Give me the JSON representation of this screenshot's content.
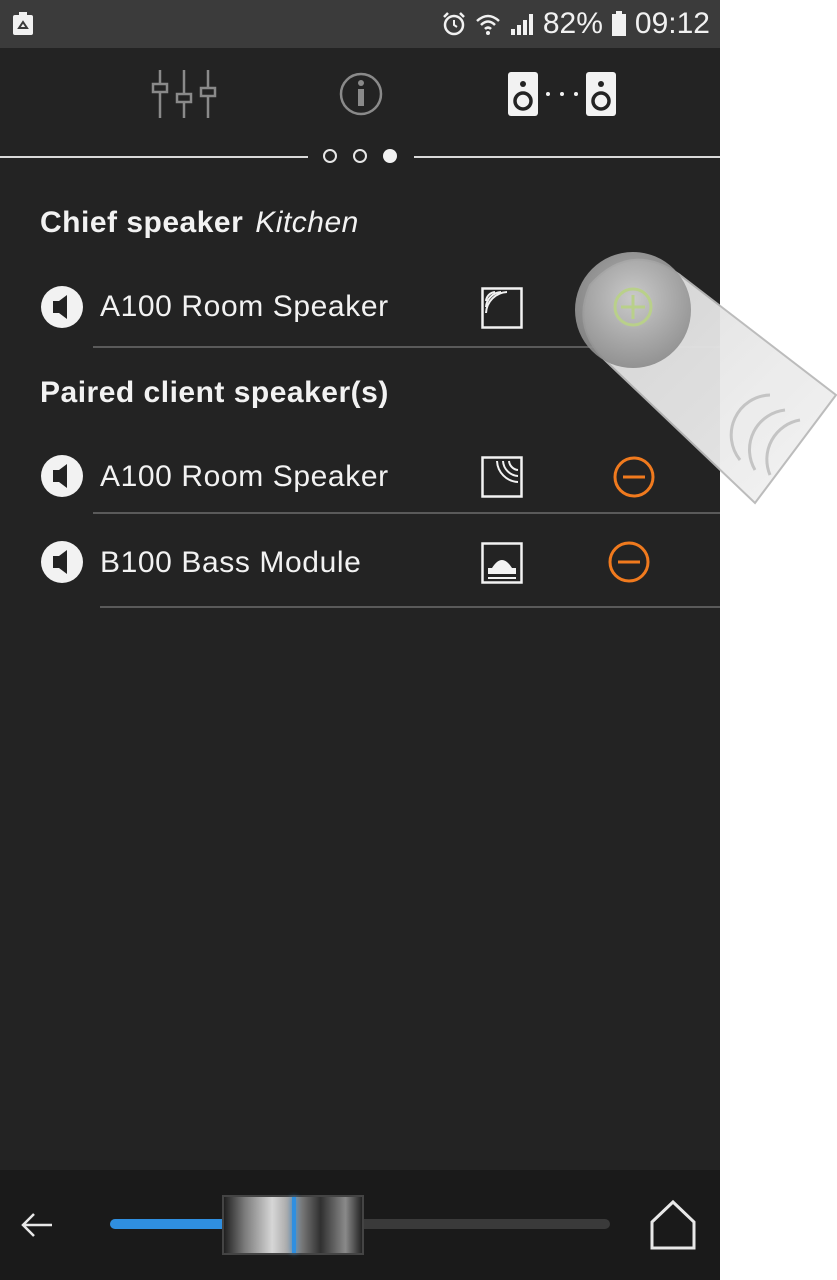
{
  "status_bar": {
    "battery_percent": "82%",
    "time": "09:12",
    "icons": [
      "recycle-icon",
      "alarm-icon",
      "wifi-icon",
      "signal-icon",
      "battery-icon"
    ]
  },
  "nav": {
    "tabs": [
      "equalizer-icon",
      "info-icon",
      "speaker-pair-icon"
    ],
    "active_page": 3,
    "page_count": 3
  },
  "chief": {
    "heading": "Chief speaker",
    "room": "Kitchen",
    "speaker": {
      "name": "A100 Room Speaker",
      "type_icon": "wall-speaker-icon",
      "action": "add"
    }
  },
  "paired": {
    "heading": "Paired client speaker(s)",
    "speakers": [
      {
        "name": "A100 Room Speaker",
        "type_icon": "wall-speaker-icon",
        "action": "remove"
      },
      {
        "name": "B100 Bass Module",
        "type_icon": "bass-module-icon",
        "action": "remove"
      }
    ]
  },
  "colors": {
    "background": "#232323",
    "accent_remove": "#f07a1e",
    "accent_add": "#b9d08a",
    "volume_fill": "#2f8fe0"
  },
  "volume": {
    "level_fraction": 0.5
  }
}
